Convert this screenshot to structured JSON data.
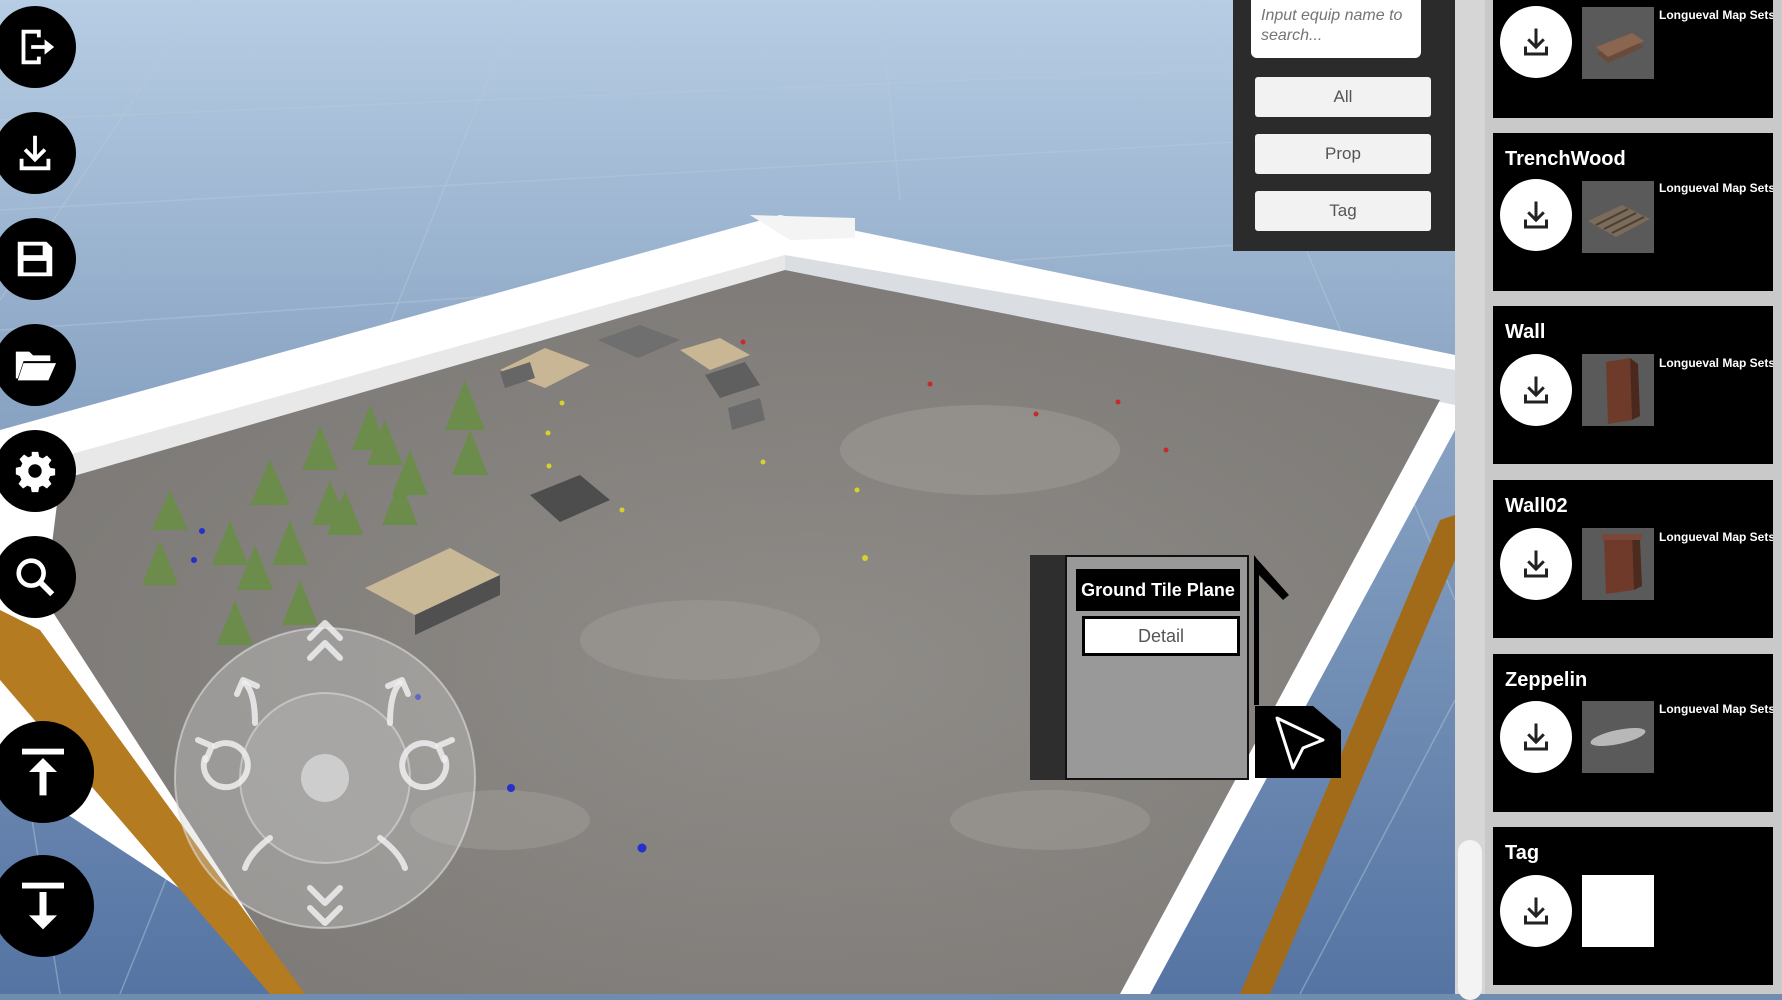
{
  "sidebar": {
    "buttons": [
      {
        "name": "exit-icon",
        "action": "exit"
      },
      {
        "name": "download-icon",
        "action": "import"
      },
      {
        "name": "save-icon",
        "action": "save"
      },
      {
        "name": "folder-open-icon",
        "action": "open"
      },
      {
        "name": "gear-icon",
        "action": "settings"
      },
      {
        "name": "search-icon",
        "action": "search"
      },
      {
        "name": "raise-icon",
        "action": "raise"
      },
      {
        "name": "lower-icon",
        "action": "lower"
      }
    ]
  },
  "filter": {
    "search_placeholder": "Input equip name to search...",
    "buttons": [
      "All",
      "Prop",
      "Tag"
    ]
  },
  "assets": {
    "items": [
      {
        "title": "",
        "source": "Longueval Map Sets",
        "thumb": "trench"
      },
      {
        "title": "TrenchWood",
        "source": "Longueval Map Sets",
        "thumb": "planks"
      },
      {
        "title": "Wall",
        "source": "Longueval Map Sets",
        "thumb": "wall"
      },
      {
        "title": "Wall02",
        "source": "Longueval Map Sets",
        "thumb": "wall"
      },
      {
        "title": "Zeppelin",
        "source": "Longueval Map Sets",
        "thumb": "zeppelin"
      },
      {
        "title": "Tag",
        "source": "",
        "thumb": "white"
      }
    ]
  },
  "context_menu": {
    "title": "Ground Tile Plane",
    "detail_label": "Detail"
  },
  "colors": {
    "panel_dark": "#2b2b2b",
    "card_bg": "#000000",
    "ground": "#8a8783",
    "wall": "#ffffff",
    "sky_water": "#6f8daf"
  }
}
